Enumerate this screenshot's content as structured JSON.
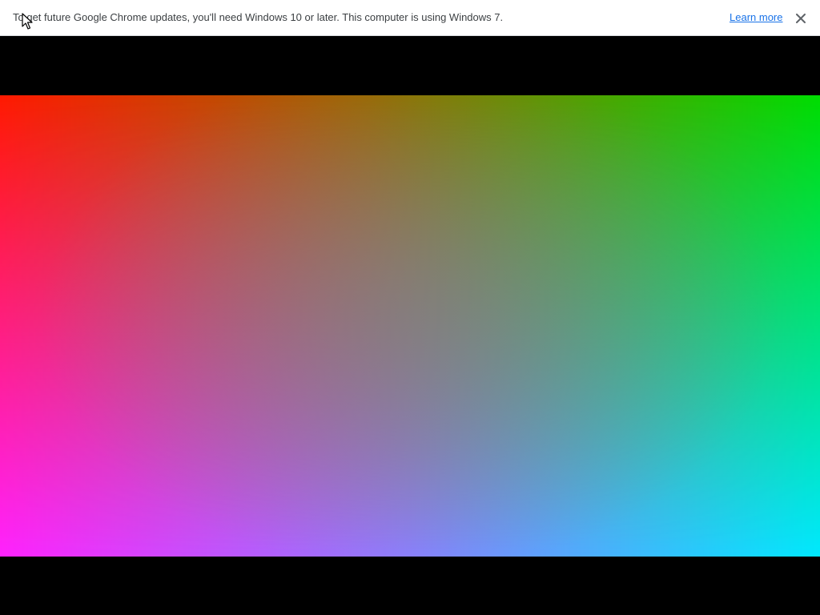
{
  "infobar": {
    "message": "To get future Google Chrome updates, you'll need Windows 10 or later. This computer is using Windows 7.",
    "link_label": "Learn more",
    "close_icon": "close-icon",
    "link_color": "#1a73e8",
    "text_color": "#3c4043"
  },
  "content": {
    "canvas_colors": {
      "top_left": "#ff1a00",
      "top_right": "#00dd00",
      "bottom_left": "#ff22ff",
      "bottom_right": "#00e8ff"
    },
    "letterbox_color": "#000000"
  },
  "cursor": {
    "icon": "mouse-pointer-icon"
  }
}
